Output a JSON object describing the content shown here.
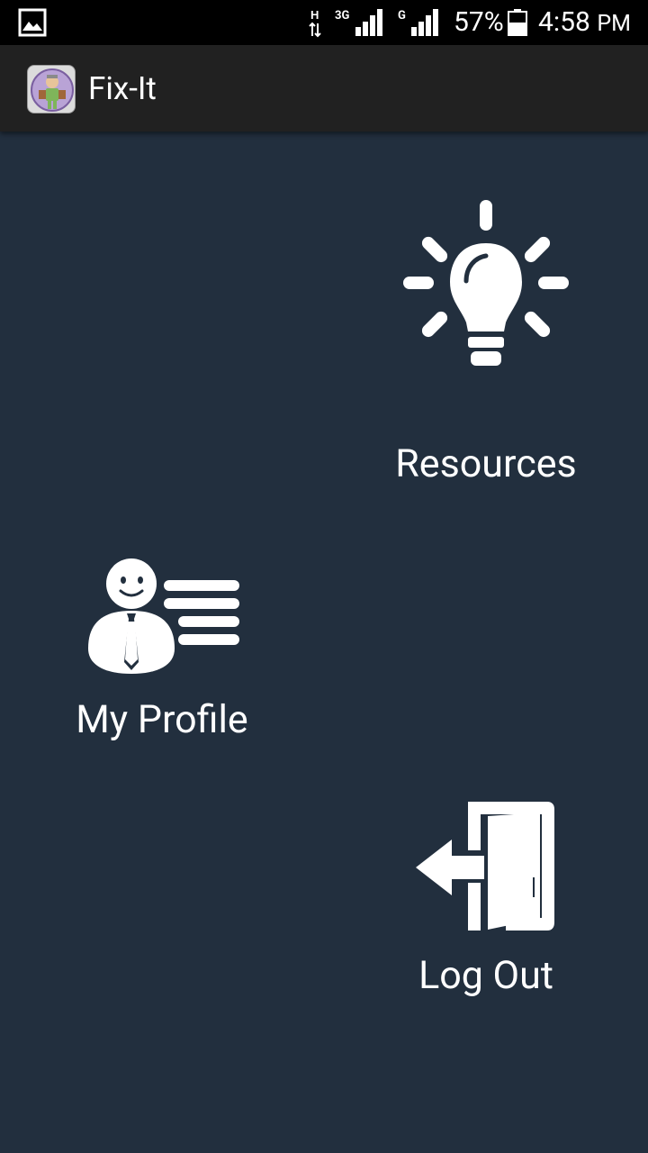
{
  "status_bar": {
    "network_label_1": "3G",
    "network_label_2": "G",
    "battery_percent": "57%",
    "time": "4:58",
    "time_suffix": "PM"
  },
  "action_bar": {
    "title": "Fix-It"
  },
  "menu": {
    "resources": {
      "label": "Resources",
      "icon": "lightbulb-icon"
    },
    "my_profile": {
      "label": "My Profile",
      "icon": "profile-card-icon"
    },
    "log_out": {
      "label": "Log Out",
      "icon": "exit-door-icon"
    }
  },
  "colors": {
    "background": "#222f3e",
    "action_bar": "#212121",
    "status_bar": "#000000",
    "icon_and_text": "#ffffff"
  }
}
